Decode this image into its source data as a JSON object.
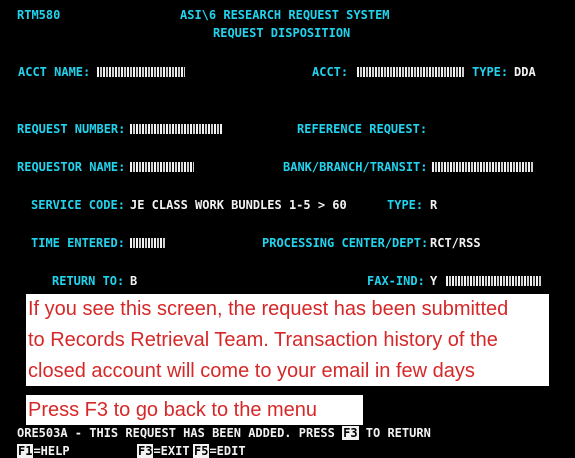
{
  "header": {
    "screen_id": "RTM580",
    "system_title": "ASI\\6 RESEARCH REQUEST SYSTEM",
    "subtitle": "REQUEST DISPOSITION"
  },
  "fields": {
    "acct_name": {
      "label": "ACCT NAME:"
    },
    "acct": {
      "label": "ACCT:"
    },
    "type_top": {
      "label": "TYPE:",
      "value": "DDA"
    },
    "request_number": {
      "label": "REQUEST NUMBER:"
    },
    "reference_request": {
      "label": "REFERENCE REQUEST:"
    },
    "requestor_name": {
      "label": "REQUESTOR NAME:"
    },
    "bank_branch_transit": {
      "label": "BANK/BRANCH/TRANSIT:"
    },
    "service_code": {
      "label": "SERVICE CODE:",
      "value": "JE CLASS WORK BUNDLES 1-5 > 60"
    },
    "type_service": {
      "label": "TYPE:",
      "value": "R"
    },
    "time_entered": {
      "label": "TIME ENTERED:"
    },
    "processing_center": {
      "label": "PROCESSING CENTER/DEPT:",
      "value": "RCT/RSS"
    },
    "return_to": {
      "label": "RETURN TO:",
      "value": "B"
    },
    "fax_ind": {
      "label": "FAX-IND:",
      "value": "Y"
    }
  },
  "overlay": {
    "note_lines": [
      "If you see this screen, the request has been submitted",
      "to Records Retrieval Team. Transaction history of the",
      "closed account will come to your email in few days"
    ],
    "instruction": "Press F3 to go back to the menu"
  },
  "status": {
    "message_prefix": "ORE503A - THIS REQUEST HAS BEEN ADDED. PRESS ",
    "message_key": "F3",
    "message_suffix": " TO RETURN"
  },
  "function_keys": [
    {
      "key": "F1",
      "label": "=HELP"
    },
    {
      "key": "F3",
      "label": "=EXIT"
    },
    {
      "key": "F5",
      "label": "=EDIT"
    }
  ],
  "colors": {
    "screen_bg": "#000000",
    "label": "#22d3ee",
    "value": "#f2f2f2",
    "overlay_text": "#d62828",
    "overlay_bg": "#ffffff"
  }
}
